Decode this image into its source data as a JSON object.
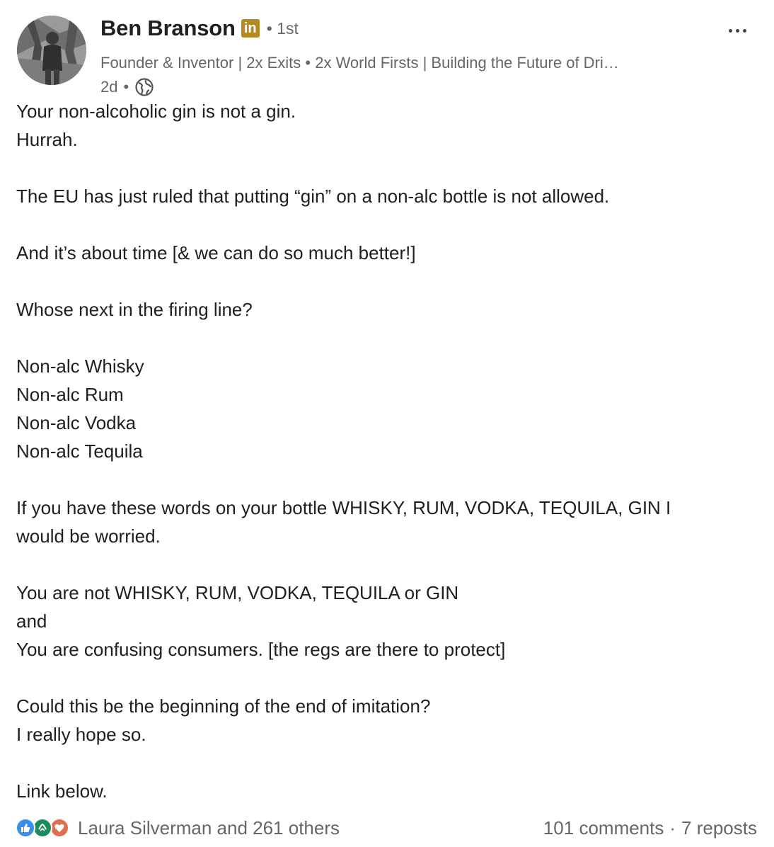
{
  "author": {
    "name": "Ben Branson",
    "badge": "in",
    "degree": "• 1st",
    "headline": "Founder & Inventor | 2x Exits • 2x World Firsts | Building the Future of Dri…",
    "time": "2d",
    "time_separator": "•",
    "visibility_icon": "globe-icon",
    "badge_color": "#b58a23"
  },
  "menu": {
    "more_icon": "more-horizontal-icon"
  },
  "post": {
    "lines": [
      "Your non-alcoholic gin is not a gin.",
      "Hurrah.",
      "",
      "The EU has just ruled that putting “gin” on a non-alc bottle is not allowed.",
      "",
      "And it’s about time [& we can do so much better!]",
      "",
      "Whose next in the firing line?",
      "",
      "Non-alc Whisky",
      "Non-alc Rum",
      "Non-alc Vodka",
      "Non-alc Tequila",
      "",
      "If you have these words on your bottle WHISKY, RUM, VODKA, TEQUILA, GIN I",
      "would be worried.",
      "",
      "You are not WHISKY, RUM, VODKA, TEQUILA or GIN",
      "and",
      "You are confusing consumers. [the regs are there to protect]",
      "",
      "Could this be the beginning of the end of imitation?",
      "I really hope so.",
      "",
      "Link below."
    ]
  },
  "social": {
    "reaction_icons": [
      "like-icon",
      "support-icon",
      "love-icon"
    ],
    "reactions_text": "Laura Silverman and 261 others",
    "comments": "101 comments",
    "separator": "·",
    "reposts": "7 reposts",
    "colors": {
      "like": "#378fe9",
      "support": "#1f8a5b",
      "love": "#df704d"
    }
  }
}
